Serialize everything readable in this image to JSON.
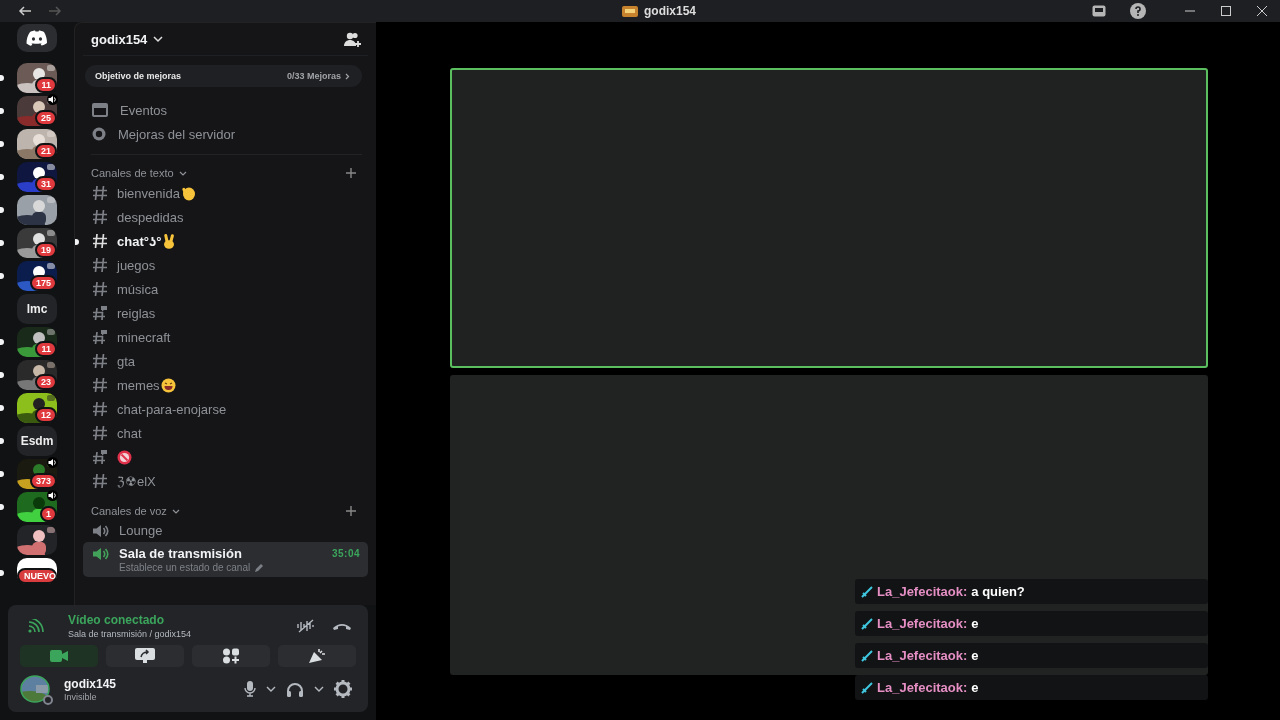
{
  "window": {
    "title": "godix154"
  },
  "servers": [
    {
      "kind": "picture",
      "badge": "11",
      "unread": true,
      "voice": false
    },
    {
      "kind": "picture",
      "badge": "25",
      "unread": true,
      "voice": true
    },
    {
      "kind": "picture",
      "badge": "21",
      "unread": true,
      "voice": false
    },
    {
      "kind": "picture",
      "badge": "31",
      "unread": true,
      "voice": false
    },
    {
      "kind": "picture",
      "unread": true,
      "voice": false
    },
    {
      "kind": "picture",
      "badge": "19",
      "unread": true,
      "voice": false
    },
    {
      "kind": "picture",
      "badge": "175",
      "unread": true,
      "voice": false
    },
    {
      "kind": "text",
      "label": "lmc",
      "unread": false,
      "voice": false
    },
    {
      "kind": "picture",
      "badge": "11",
      "unread": true,
      "voice": false
    },
    {
      "kind": "picture",
      "badge": "23",
      "unread": true,
      "voice": false
    },
    {
      "kind": "picture",
      "badge": "12",
      "unread": true,
      "voice": false
    },
    {
      "kind": "text",
      "label": "Esdm",
      "unread": true,
      "voice": false
    },
    {
      "kind": "picture",
      "badge": "373",
      "unread": true,
      "voice": true
    },
    {
      "kind": "picture",
      "badge": "1",
      "unread": true,
      "voice": true
    },
    {
      "kind": "picture",
      "unread": false,
      "voice": false
    },
    {
      "kind": "new",
      "badge": "NUEVO",
      "unread": true,
      "voice": false
    }
  ],
  "server_name": "godix154",
  "boost": {
    "label": "Objetivo de mejoras",
    "progress": "0/33 Mejoras"
  },
  "menu": [
    {
      "kind": "calendar",
      "label": "Eventos"
    },
    {
      "kind": "boost",
      "label": "Mejoras del servidor"
    }
  ],
  "text_category": "Canales de texto",
  "text_channels": [
    {
      "kind": "text",
      "name": "bienvenida",
      "emoji": {
        "kind": "wave"
      },
      "unread": false
    },
    {
      "kind": "text",
      "name": "despedidas",
      "unread": false
    },
    {
      "kind": "text",
      "name": "chat°ʖ°",
      "emoji": {
        "kind": "victory"
      },
      "unread": true
    },
    {
      "kind": "text",
      "name": "juegos",
      "unread": false
    },
    {
      "kind": "text",
      "name": "música",
      "unread": false
    },
    {
      "kind": "thread",
      "name": "reiglas",
      "unread": false
    },
    {
      "kind": "thread",
      "name": "minecraft",
      "unread": false
    },
    {
      "kind": "text",
      "name": "gta",
      "unread": false
    },
    {
      "kind": "text",
      "name": "memes",
      "emoji": {
        "kind": "laugh"
      },
      "unread": false
    },
    {
      "kind": "text",
      "name": "chat-para-enojarse",
      "unread": false
    },
    {
      "kind": "text",
      "name": "chat",
      "unread": false
    },
    {
      "kind": "thread",
      "emoji": {
        "kind": "no-entry"
      },
      "unread": false
    },
    {
      "kind": "text",
      "name": "ℨ☢elX",
      "unread": false
    }
  ],
  "voice_category": "Canales de voz",
  "voice_channels": [
    {
      "name": "Lounge",
      "selected": false
    },
    {
      "name": "Sala de transmisión",
      "selected": true,
      "status": "Establece un estado de canal",
      "timer": "35:04"
    }
  ],
  "connection": {
    "status": "Vídeo conectado",
    "channel": "Sala de transmisión / godix154"
  },
  "controls": [
    {
      "kind": "camera",
      "on": true
    },
    {
      "kind": "screen",
      "on": false
    },
    {
      "kind": "activity",
      "on": false
    },
    {
      "kind": "soundboard",
      "on": false
    }
  ],
  "user": {
    "name": "godix145",
    "status": "Invisible"
  },
  "tiles": [
    {
      "speaking": true
    },
    {
      "speaking": false
    }
  ],
  "chat_messages": [
    {
      "author": "La_Jefecitaok:",
      "text": "a quien?"
    },
    {
      "author": "La_Jefecitaok:",
      "text": "e"
    },
    {
      "author": "La_Jefecitaok:",
      "text": "e"
    },
    {
      "author": "La_Jefecitaok:",
      "text": "e"
    }
  ]
}
